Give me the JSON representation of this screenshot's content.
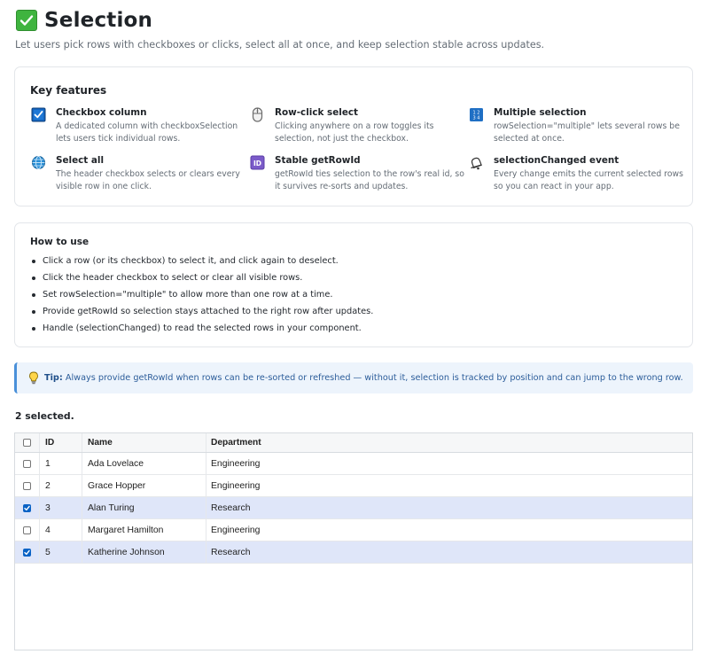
{
  "header": {
    "title": "Selection",
    "subtitle": "Let users pick rows with checkboxes or clicks, select all at once, and keep selection stable across updates."
  },
  "features": {
    "heading": "Key features",
    "items": [
      {
        "icon": "checkbox-icon",
        "title": "Checkbox column",
        "desc": "A dedicated column with checkboxSelection lets users tick individual rows."
      },
      {
        "icon": "mouse-icon",
        "title": "Row-click select",
        "desc": "Clicking anywhere on a row toggles its selection, not just the checkbox."
      },
      {
        "icon": "numbers-icon",
        "title": "Multiple selection",
        "desc": "rowSelection=\"multiple\" lets several rows be selected at once."
      },
      {
        "icon": "globe-icon",
        "title": "Select all",
        "desc": "The header checkbox selects or clears every visible row in one click."
      },
      {
        "icon": "id-icon",
        "title": "Stable getRowId",
        "desc": "getRowId ties selection to the row's real id, so it survives re-sorts and updates."
      },
      {
        "icon": "bell-icon",
        "title": "selectionChanged event",
        "desc": "Every change emits the current selected rows so you can react in your app."
      }
    ]
  },
  "howto": {
    "heading": "How to use",
    "steps": [
      "Click a row (or its checkbox) to select it, and click again to deselect.",
      "Click the header checkbox to select or clear all visible rows.",
      "Set rowSelection=\"multiple\" to allow more than one row at a time.",
      "Provide getRowId so selection stays attached to the right row after updates.",
      "Handle (selectionChanged) to read the selected rows in your component."
    ]
  },
  "tip": {
    "label": "Tip:",
    "text": "Always provide getRowId when rows can be re-sorted or refreshed — without it, selection is tracked by position and can jump to the wrong row."
  },
  "selection_status": "2 selected.",
  "grid": {
    "columns": [
      "ID",
      "Name",
      "Department"
    ],
    "header_checked": false,
    "rows": [
      {
        "id": "1",
        "name": "Ada Lovelace",
        "department": "Engineering",
        "selected": false
      },
      {
        "id": "2",
        "name": "Grace Hopper",
        "department": "Engineering",
        "selected": false
      },
      {
        "id": "3",
        "name": "Alan Turing",
        "department": "Research",
        "selected": true
      },
      {
        "id": "4",
        "name": "Margaret Hamilton",
        "department": "Engineering",
        "selected": false
      },
      {
        "id": "5",
        "name": "Katherine Johnson",
        "department": "Research",
        "selected": true
      }
    ]
  },
  "colors": {
    "accent": "#0b63c5",
    "selected_row": "#dfe6f9",
    "tip_background": "#edf4fc",
    "tip_border": "#4a90d9",
    "title_check": "#3fb43f"
  }
}
